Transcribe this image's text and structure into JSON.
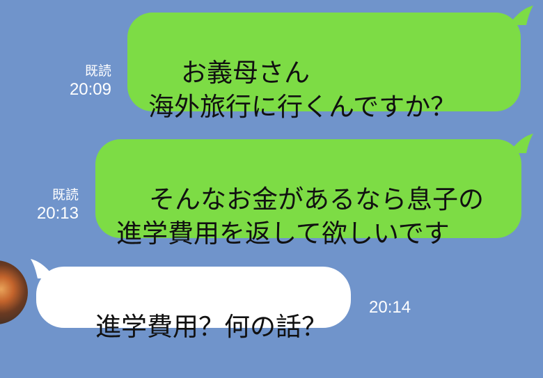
{
  "colors": {
    "background": "#7094cb",
    "outgoing_bubble": "#7ddc45",
    "incoming_bubble": "#ffffff",
    "meta_text": "#ffffff"
  },
  "messages": [
    {
      "direction": "outgoing",
      "text": "お義母さん\n海外旅行に行くんですか？",
      "read_label": "既読",
      "time": "20:09"
    },
    {
      "direction": "outgoing",
      "text": "そんなお金があるなら息子の\n進学費用を返して欲しいです",
      "read_label": "既読",
      "time": "20:13"
    },
    {
      "direction": "incoming",
      "text": "進学費用？何の話？",
      "time": "20:14",
      "avatar_icon": "sunset-avatar"
    }
  ]
}
